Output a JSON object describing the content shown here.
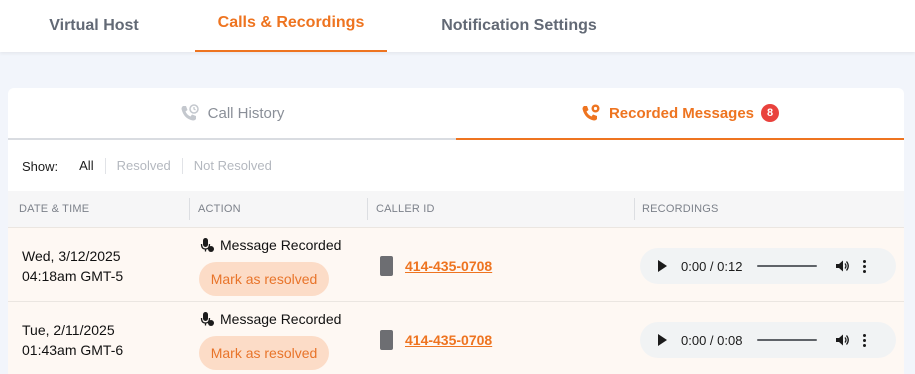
{
  "top_tabs": [
    {
      "label": "Virtual Host"
    },
    {
      "label": "Calls & Recordings"
    },
    {
      "label": "Notification Settings"
    }
  ],
  "sub_tabs": {
    "call_history": "Call History",
    "recorded_messages": "Recorded Messages",
    "recorded_count": "8"
  },
  "filters": {
    "label": "Show:",
    "options": [
      "All",
      "Resolved",
      "Not Resolved"
    ],
    "selected": "All"
  },
  "table": {
    "headers": [
      "DATE & TIME",
      "ACTION",
      "CALLER ID",
      "RECORDINGS"
    ],
    "rows": [
      {
        "date": "Wed, 3/12/2025",
        "time": "04:18am GMT-5",
        "action": "Message Recorded",
        "resolve": "Mark as resolved",
        "caller_id": "414-435-0708",
        "audio_time": "0:00 / 0:12"
      },
      {
        "date": "Tue, 2/11/2025",
        "time": "01:43am GMT-6",
        "action": "Message Recorded",
        "resolve": "Mark as resolved",
        "caller_id": "414-435-0708",
        "audio_time": "0:00 / 0:08"
      }
    ]
  },
  "colors": {
    "accent": "#ee7420",
    "badge": "#e9423d",
    "row_bg": "#fef8f3",
    "resolve_bg": "#fcdcc7"
  },
  "icons": [
    "call-history-icon",
    "recorded-messages-icon",
    "microphone-icon",
    "phone-icon",
    "play-icon",
    "volume-icon",
    "more-options-icon"
  ]
}
